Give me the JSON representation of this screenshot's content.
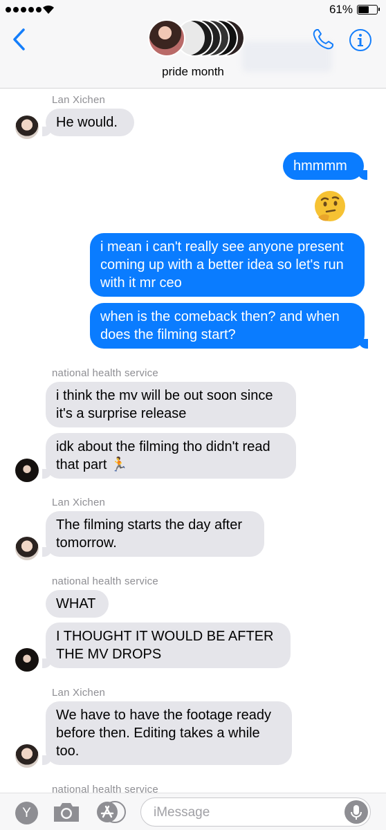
{
  "status_bar": {
    "battery_percent": "61%",
    "battery_level": 0.61
  },
  "header": {
    "group_name": "pride month",
    "back_icon": "chevron-left-icon",
    "phone_icon": "phone-icon",
    "info_icon": "info-icon",
    "accent_color": "#147efb"
  },
  "messages": [
    {
      "type": "sender",
      "text": "Lan Xichen"
    },
    {
      "type": "in",
      "text": "He would."
    },
    {
      "type": "out",
      "text": "hmmmm"
    },
    {
      "type": "emoji",
      "name": "thinking-face-icon"
    },
    {
      "type": "out",
      "text": "i mean i can't really see anyone present coming up with a better idea so let's run with it mr ceo"
    },
    {
      "type": "out",
      "text": "when is the comeback then? and when does the filming start?"
    },
    {
      "type": "sender",
      "text": "national health service"
    },
    {
      "type": "in",
      "text": "i think the mv will be out soon since it's a surprise release"
    },
    {
      "type": "in",
      "text": "idk about the filming tho didn't read that part 🏃"
    },
    {
      "type": "sender",
      "text": "Lan Xichen"
    },
    {
      "type": "in",
      "text": "The filming starts the day after tomorrow."
    },
    {
      "type": "sender",
      "text": "national health service"
    },
    {
      "type": "in",
      "text": "WHAT"
    },
    {
      "type": "in",
      "text": "I THOUGHT IT WOULD BE AFTER THE MV DROPS"
    },
    {
      "type": "sender",
      "text": "Lan Xichen"
    },
    {
      "type": "in",
      "text": "We have to have the footage ready before then. Editing takes a while too."
    },
    {
      "type": "sender",
      "text": "national health service"
    }
  ],
  "composer": {
    "placeholder": "iMessage",
    "app_button_label": "Y",
    "camera_icon": "camera-icon",
    "appstore_icon": "app-store-icon",
    "mic_icon": "microphone-icon"
  },
  "colors": {
    "incoming_bubble": "#e5e5ea",
    "outgoing_bubble": "#0a7cff",
    "sender_label": "#8e8e93"
  }
}
